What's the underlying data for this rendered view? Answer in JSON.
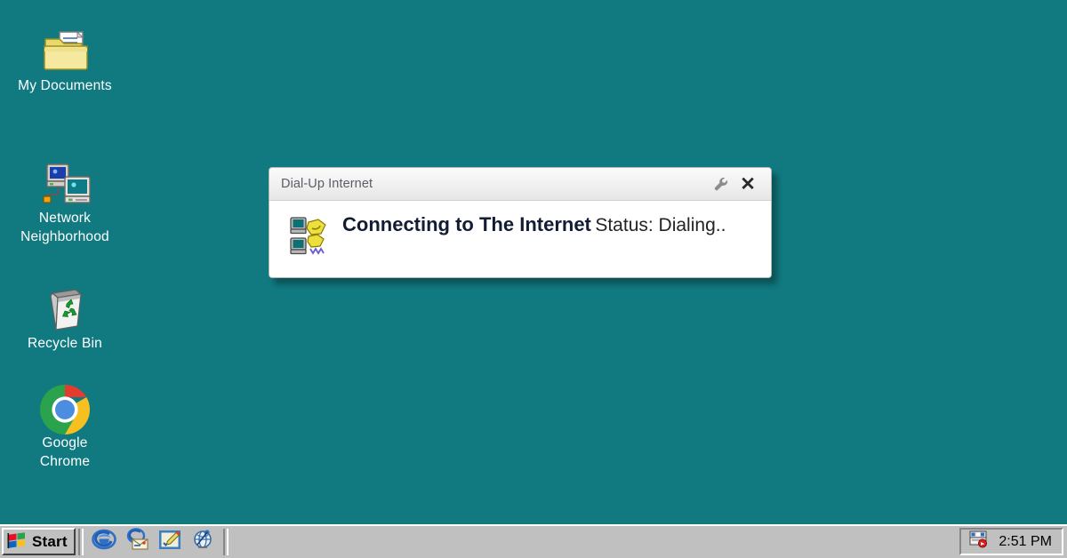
{
  "theme": {
    "desktop_bg": "#107a80",
    "taskbar_bg": "#c0c0c0",
    "dialog_bg": "#ffffff",
    "titlebar_bg": "#f2f2f2",
    "heading_color": "#131c33",
    "label_color": "#ffffff"
  },
  "desktop": {
    "icons": [
      {
        "id": "my-documents",
        "label": "My Documents",
        "icon": "folder-documents-icon"
      },
      {
        "id": "network-neighborhood",
        "label": "Network\nNeighborhood",
        "icon": "network-computers-icon"
      },
      {
        "id": "recycle-bin",
        "label": "Recycle Bin",
        "icon": "recycle-bin-icon"
      },
      {
        "id": "google-chrome",
        "label": "Google\nChrome",
        "icon": "chrome-icon"
      }
    ]
  },
  "dialog": {
    "title": "Dial-Up Internet",
    "heading": "Connecting to The Internet",
    "status": "Status: Dialing..",
    "icon": "dialup-connection-icon",
    "titlebar_buttons": [
      {
        "id": "settings",
        "icon": "wrench-icon",
        "label": ""
      },
      {
        "id": "close",
        "icon": "close-icon",
        "label": "✕"
      }
    ]
  },
  "taskbar": {
    "start_label": "Start",
    "start_icon": "windows-flag-icon",
    "quick_launch": [
      {
        "id": "internet-explorer",
        "icon": "internet-explorer-icon"
      },
      {
        "id": "outlook-express",
        "icon": "outlook-express-icon"
      },
      {
        "id": "notepad",
        "icon": "notepad-pencil-icon"
      },
      {
        "id": "active-desktop",
        "icon": "globe-icon"
      }
    ],
    "systray": {
      "icons": [
        {
          "id": "dialup-status",
          "icon": "dialup-tray-icon"
        }
      ],
      "clock": "2:51 PM"
    }
  }
}
